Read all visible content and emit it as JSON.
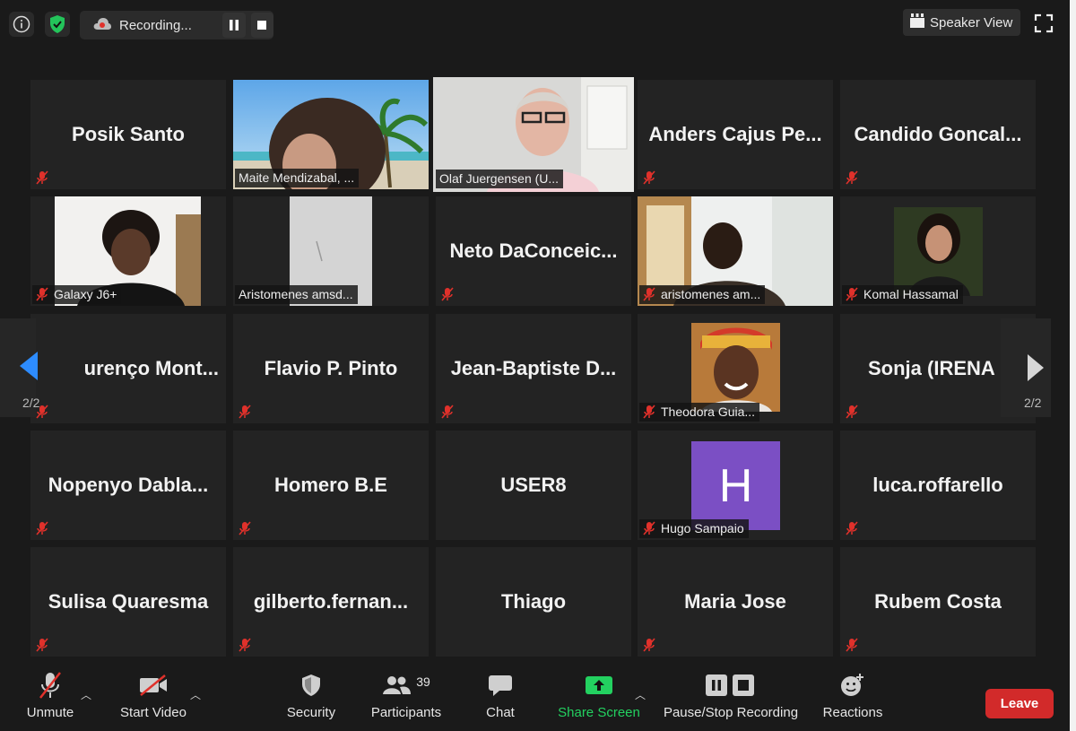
{
  "topbar": {
    "recording_label": "Recording...",
    "speaker_view_label": "Speaker View"
  },
  "grid": {
    "row1": [
      "Posik Santo",
      "Maite Mendizabal, ...",
      "Olaf Juergensen (U...",
      "Anders  Cajus  Pe...",
      "Candido  Goncal..."
    ],
    "row2": [
      "Galaxy J6+",
      "Aristomenes amsd...",
      "Neto  DaConceic...",
      "aristomenes am...",
      "Komal Hassamal"
    ],
    "row3": [
      "urenço  Mont...",
      "Flavio P. Pinto",
      "Jean-Baptiste  D...",
      "Theodora Guia...",
      "Sonja (IRENA"
    ],
    "row4": [
      "Nopenyo  Dabla...",
      "Homero B.E",
      "USER8",
      "Hugo Sampaio",
      "luca.roffarello"
    ],
    "row5": [
      "Sulisa Quaresma",
      "gilberto.fernan...",
      "Thiago",
      "Maria Jose",
      "Rubem Costa"
    ],
    "hugo_avatar_letter": "H"
  },
  "paging": {
    "left": "2/2",
    "right": "2/2"
  },
  "toolbar": {
    "unmute": "Unmute",
    "start_video": "Start Video",
    "security": "Security",
    "participants": "Participants",
    "participants_count": "39",
    "chat": "Chat",
    "share_screen": "Share Screen",
    "recording": "Pause/Stop Recording",
    "reactions": "Reactions",
    "leave": "Leave"
  },
  "colors": {
    "active_speaker": "#b8e04a",
    "share_green": "#23d160",
    "leave_red": "#d22a2a",
    "mute_red": "#e0312b",
    "avatar_purple": "#7b4fc4"
  }
}
